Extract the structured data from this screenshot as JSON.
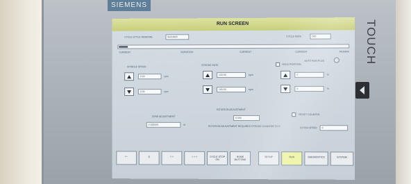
{
  "device": {
    "brand": "SIEMENS",
    "model_label": "TOUCH"
  },
  "screen": {
    "title": "RUN SCREEN",
    "header_left": "CYCLE STYLE REMOVAL",
    "header_left_value": "BUSHER",
    "header_right": "CYCLE RATE",
    "header_right_value": "000",
    "progress_start": "0",
    "progress_fraction": 0.04,
    "axis_labels": [
      "CURRENT",
      "DURATION",
      "CURRENT",
      "CURRENT"
    ],
    "axis_label_right": "REMAIN",
    "auto_run_label": "AUTO RUN PLUS",
    "speed": {
      "label": "SPINDLE SPEED",
      "set_value": "0.00",
      "set_unit": "rpm",
      "actual_value": "0.00",
      "actual_unit": "rpm"
    },
    "rate": {
      "label": "STROKE RATE",
      "set_value": "120.00",
      "set_unit": "spm",
      "actual_value": "100.00",
      "actual_unit": "spm"
    },
    "position": {
      "label": "HOLD POSITION",
      "set_value": "0",
      "set_unit": "%",
      "actual_value": "0",
      "actual_unit": "%"
    },
    "zone": {
      "label": "ZONE ADJUSTMENT",
      "value": "0.000000",
      "unit": "in"
    },
    "rotation": {
      "label": "ROTATION ADJUSTMENT",
      "value": "0.000",
      "note": "ROTATION ADJUSTMENT REQUIRES STROKE COUNTER TO 0"
    },
    "reset_label": "RESET COUNTER",
    "speed_count_label": "EXTRA SPEED",
    "speed_count_value": "0",
    "buttons": [
      "<--",
      "||",
      "< <",
      "> > >",
      "CYCLE STOP ON",
      "HOME BUTTONS",
      "SETUP",
      "RUN",
      "DIAGNOSTICS",
      "SYSTEM"
    ],
    "active_button": "RUN"
  }
}
